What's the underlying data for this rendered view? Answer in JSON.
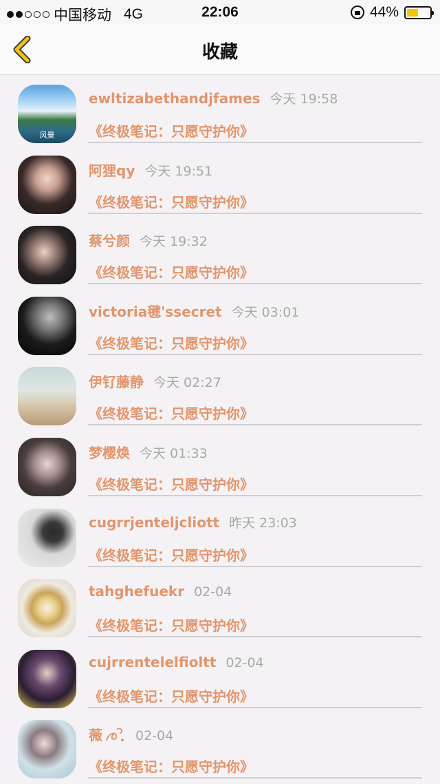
{
  "status_bar": {
    "carrier": "中国移动",
    "network": "4G",
    "time": "22:06",
    "battery_percent": "44%",
    "battery_level": 0.44,
    "battery_color": "#f5c400",
    "signal_dots_filled": 2,
    "signal_dots_total": 5
  },
  "nav": {
    "title": "收藏",
    "back_icon": "chevron-left-icon",
    "back_color": "#f5c400"
  },
  "accent_color": "#e2956b",
  "items": [
    {
      "name": "ewltizabethandjfames",
      "time": "今天 19:58",
      "book": "《终极笔记：只愿守护你》",
      "avatar_text": "风景"
    },
    {
      "name": "阿狸qy",
      "time": "今天 19:51",
      "book": "《终极笔记：只愿守护你》"
    },
    {
      "name": "蔡兮颜",
      "time": "今天 19:32",
      "book": "《终极笔记：只愿守护你》"
    },
    {
      "name": "victoria毽'ssecret",
      "time": "今天 03:01",
      "book": "《终极笔记：只愿守护你》"
    },
    {
      "name": "伊钌藤静",
      "time": "今天 02:27",
      "book": "《终极笔记：只愿守护你》"
    },
    {
      "name": "梦樱焕",
      "time": "今天 01:33",
      "book": "《终极笔记：只愿守护你》"
    },
    {
      "name": "cugrrjenteljcliott",
      "time": "昨天 23:03",
      "book": "《终极笔记：只愿守护你》"
    },
    {
      "name": "tahghefuekr",
      "time": "02-04",
      "book": "《终极笔记：只愿守护你》"
    },
    {
      "name": "cujrrentelelfioltt",
      "time": "02-04",
      "book": "《终极笔记：只愿守护你》"
    },
    {
      "name": "薇",
      "time": "02-04",
      "book": "《终极笔记：只愿守护你》"
    }
  ]
}
